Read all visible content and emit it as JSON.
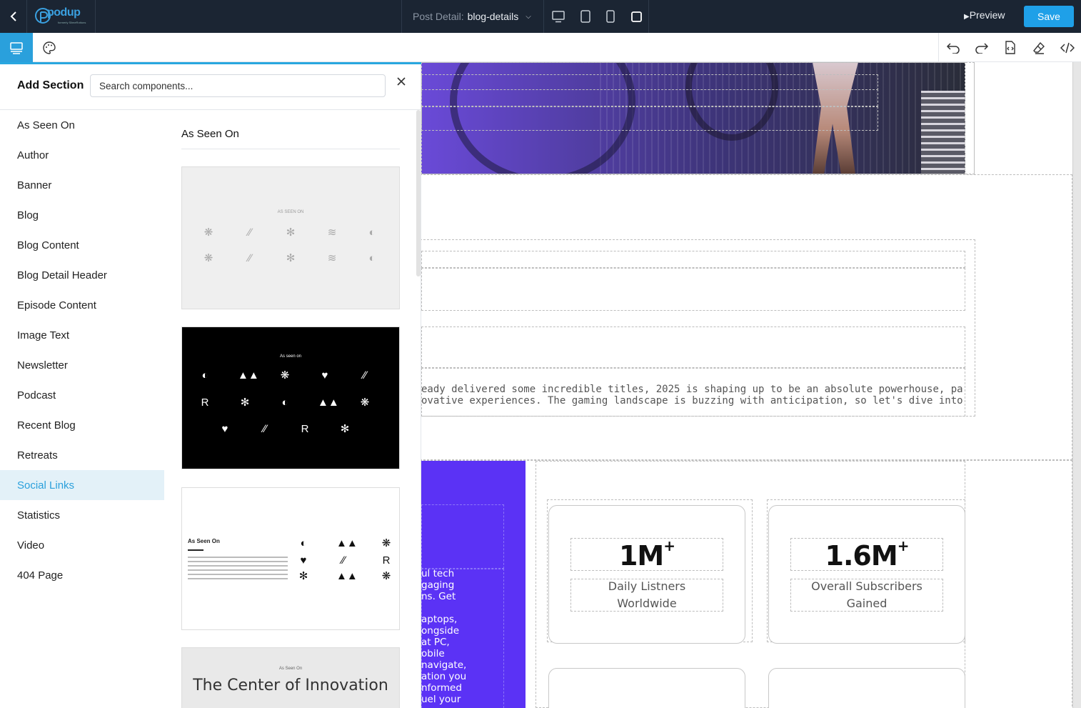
{
  "topbar": {
    "logo_text": "podup",
    "logo_sub": "formerly SlimeRottons",
    "post_label": "Post Detail:",
    "post_value": "blog-details",
    "preview_label": "Preview",
    "save_label": "Save"
  },
  "panel": {
    "title": "Add Section",
    "search_placeholder": "Search components...",
    "categories": [
      {
        "label": "As Seen On"
      },
      {
        "label": "Author"
      },
      {
        "label": "Banner"
      },
      {
        "label": "Blog"
      },
      {
        "label": "Blog Content"
      },
      {
        "label": "Blog Detail Header"
      },
      {
        "label": "Episode Content"
      },
      {
        "label": "Image Text"
      },
      {
        "label": "Newsletter"
      },
      {
        "label": "Podcast"
      },
      {
        "label": "Recent Blog"
      },
      {
        "label": "Retreats"
      },
      {
        "label": "Social Links"
      },
      {
        "label": "Statistics"
      },
      {
        "label": "Video"
      },
      {
        "label": "404 Page"
      }
    ],
    "active_category": "Social Links",
    "gallery_title": "As Seen On",
    "thumbs": [
      {
        "mini_title": "AS SEEN ON"
      },
      {
        "mini_title": "As seen on"
      },
      {
        "mini_title": "As Seen On"
      },
      {
        "mini_title": "As Seen On",
        "headline": "The Center of Innovation"
      }
    ]
  },
  "canvas": {
    "article_line1": "eady delivered some incredible titles, 2025 is shaping up to be an absolute powerhouse, packed with a perfect",
    "article_line2": "ovative experiences. The gaming landscape is buzzing with anticipation, so let's dive into some of the hottest",
    "purple_text": "ul tech\ngaging\nns. Get\n\naptops,\nongside\nat PC,\nobile\nnavigate,\nation you\nnformed\nuel your",
    "stats": [
      {
        "value": "1M",
        "suffix": "+",
        "label_line1": "Daily Listners",
        "label_line2": "Worldwide"
      },
      {
        "value": "1.6M",
        "suffix": "+",
        "label_line1": "Overall Subscribers",
        "label_line2": "Gained"
      }
    ]
  },
  "colors": {
    "topbar_bg": "#1b2533",
    "accent": "#1fa0e8",
    "active_bg": "#e3f1f8",
    "purple": "#5b32f5"
  },
  "icons": [
    "back-arrow-icon",
    "desktop-icon",
    "tablet-icon",
    "mobile-icon",
    "square-icon",
    "play-icon",
    "sections-icon",
    "palette-icon",
    "undo-icon",
    "redo-icon",
    "code-file-icon",
    "eraser-icon",
    "code-icon",
    "close-icon"
  ]
}
